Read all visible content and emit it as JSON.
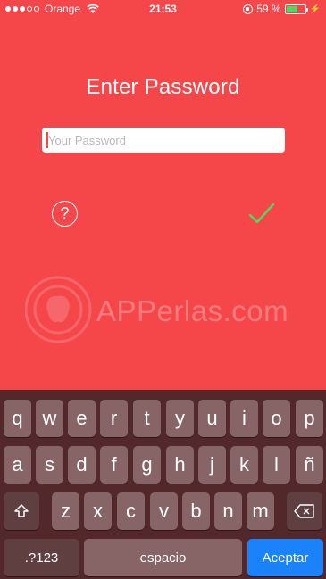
{
  "status_bar": {
    "carrier": "Orange",
    "time": "21:53",
    "battery_percent_label": "59 %",
    "battery_level": 0.59,
    "signal_bars_filled": 3,
    "signal_bars_total": 5
  },
  "login": {
    "title": "Enter Password",
    "password_placeholder": "Your Password",
    "help_symbol": "?",
    "submit_icon": "checkmark-icon"
  },
  "watermark": {
    "text": "APPerlas.com"
  },
  "keyboard": {
    "row1": [
      "q",
      "w",
      "e",
      "r",
      "t",
      "y",
      "u",
      "i",
      "o",
      "p"
    ],
    "row2": [
      "a",
      "s",
      "d",
      "f",
      "g",
      "h",
      "j",
      "k",
      "l",
      "ñ"
    ],
    "row3": [
      "z",
      "x",
      "c",
      "v",
      "b",
      "n",
      "m"
    ],
    "shift_icon": "shift-icon",
    "delete_icon": "backspace-icon",
    "numbers_label": ".?123",
    "space_label": "espacio",
    "accept_label": "Aceptar"
  },
  "colors": {
    "background": "#f5464a",
    "keyboard_bg": "#53282a",
    "key": "#876465",
    "accept": "#1a82fb",
    "check": "#4cd964"
  }
}
